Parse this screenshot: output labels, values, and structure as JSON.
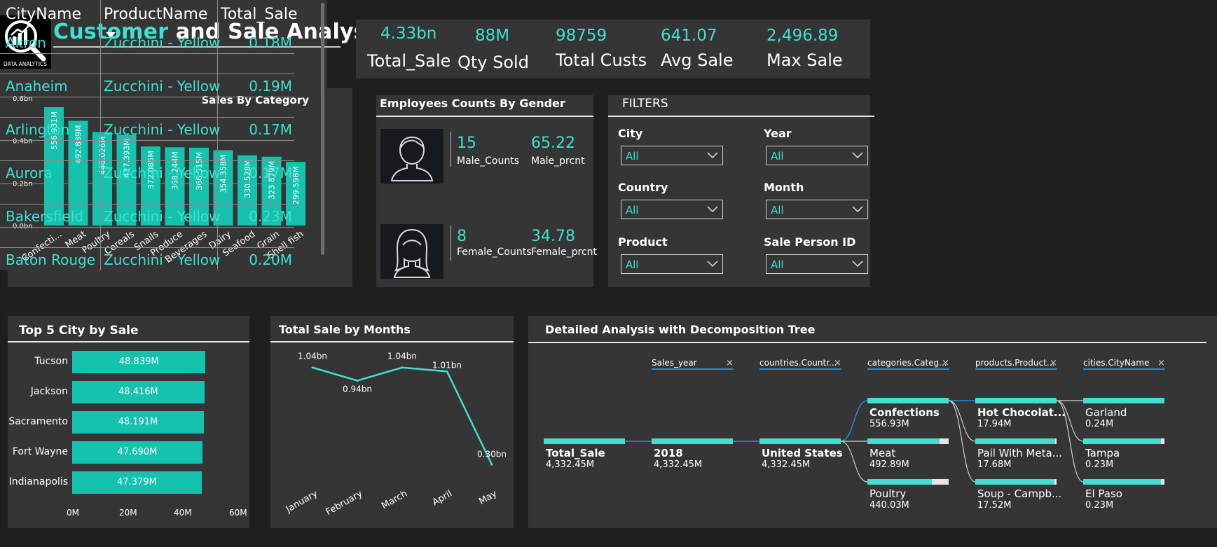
{
  "header": {
    "logo_text": "DATA ANALYTICS",
    "title_part1": "Customer",
    "title_part2": " and Sale Analysis"
  },
  "kpis": [
    {
      "value": "4.33bn",
      "label": "Total_Sale"
    },
    {
      "value": "88M",
      "label": "Qty Sold"
    },
    {
      "value": "98759",
      "label": "Total Custs"
    },
    {
      "value": "641.07",
      "label": "Avg Sale"
    },
    {
      "value": "2,496.89",
      "label": "Max Sale"
    }
  ],
  "colors": {
    "accent": "#3fe0d0",
    "bar": "#15c2ad",
    "panel": "#353535",
    "background": "#1f1f1f",
    "tree_link": "#1f8be0"
  },
  "employees": {
    "title": "Employees Counts By Gender",
    "male": {
      "count": "15",
      "count_label": "Male_Counts",
      "pct": "65.22",
      "pct_label": "Male_prcnt",
      "icon": "male-avatar-icon"
    },
    "female": {
      "count": "8",
      "count_label": "Female_Counts",
      "pct": "34.78",
      "pct_label": "Female_prcnt",
      "icon": "female-avatar-icon"
    }
  },
  "filters": {
    "title": "FILTERS",
    "items": [
      {
        "label": "City",
        "value": "All"
      },
      {
        "label": "Year",
        "value": "All"
      },
      {
        "label": "Country",
        "value": "All"
      },
      {
        "label": "Month",
        "value": "All"
      },
      {
        "label": "Product",
        "value": "All"
      },
      {
        "label": "Sale Person ID",
        "value": "All"
      }
    ]
  },
  "table": {
    "columns": [
      "CityName",
      "ProductName",
      "Total_Sale"
    ],
    "sorted_column": "ProductName",
    "rows": [
      [
        "Akron",
        "Zucchini - Yellow",
        "0.18M"
      ],
      [
        "Anaheim",
        "Zucchini - Yellow",
        "0.19M"
      ],
      [
        "Arlington",
        "Zucchini - Yellow",
        "0.17M"
      ],
      [
        "Aurora",
        "Zucchini - Yellow",
        "0.17M"
      ],
      [
        "Bakersfield",
        "Zucchini - Yellow",
        "0.23M"
      ],
      [
        "Baton Rouge",
        "Zucchini - Yellow",
        "0.20M"
      ]
    ]
  },
  "top5": {
    "title": "Top 5 City by Sale",
    "cities": [
      "Tucson",
      "Jackson",
      "Sacramento",
      "Fort Wayne",
      "Indianapolis"
    ],
    "labels": [
      "48.839M",
      "48.416M",
      "48.191M",
      "47.690M",
      "47.379M"
    ],
    "ticks": [
      "0M",
      "20M",
      "40M",
      "60M"
    ]
  },
  "decomp": {
    "title": "Detailed Analysis with Decomposition Tree",
    "levels": [
      "Sales_year",
      "countries.Countr...",
      "categories.Categ...",
      "products.Product...",
      "cities.CityName"
    ],
    "root": {
      "name": "Total_Sale",
      "value": "4,332.45M"
    },
    "year": {
      "name": "2018",
      "value": "4,332.45M"
    },
    "country": {
      "name": "United States",
      "value": "4,332.45M"
    },
    "categories": [
      {
        "name": "Confections",
        "value": "556.93M",
        "fill": 1.0
      },
      {
        "name": "Meat",
        "value": "492.89M",
        "fill": 0.885
      },
      {
        "name": "Poultry",
        "value": "440.03M",
        "fill": 0.79
      }
    ],
    "products": [
      {
        "name": "Hot Chocolat...",
        "value": "17.94M",
        "fill": 1.0
      },
      {
        "name": "Pail With Meta...",
        "value": "17.68M",
        "fill": 0.985
      },
      {
        "name": "Soup - Campb...",
        "value": "17.52M",
        "fill": 0.977
      }
    ],
    "cities": [
      {
        "name": "Garland",
        "value": "0.24M",
        "fill": 1.0
      },
      {
        "name": "Tampa",
        "value": "0.23M",
        "fill": 0.958
      },
      {
        "name": "El Paso",
        "value": "0.23M",
        "fill": 0.958
      }
    ]
  },
  "chart_data": [
    {
      "type": "bar",
      "title": "Sales By Category",
      "categories": [
        "Confecti...",
        "Meat",
        "Poultry",
        "Cereals",
        "Snails",
        "Produce",
        "Beverages",
        "Dairy",
        "Seafood",
        "Grain",
        "Shell fish"
      ],
      "values": [
        556.931,
        492.889,
        440.026,
        427.393,
        372.085,
        368.244,
        366.515,
        354.358,
        330.528,
        323.879,
        299.598
      ],
      "value_labels": [
        "556.931M",
        "492.889M",
        "440.026M",
        "427.393M",
        "372.085M",
        "368.244M",
        "366.515M",
        "354.358M",
        "330.528M",
        "323.879M",
        "299.598M"
      ],
      "y_ticks": [
        "0.0bn",
        "0.2bn",
        "0.4bn",
        "0.6bn"
      ],
      "ylim": [
        0,
        600
      ],
      "y_unit": "M"
    },
    {
      "type": "bar",
      "title": "Top 5 City by Sale",
      "orientation": "horizontal",
      "categories": [
        "Tucson",
        "Jackson",
        "Sacramento",
        "Fort Wayne",
        "Indianapolis"
      ],
      "values": [
        48.839,
        48.416,
        48.191,
        47.69,
        47.379
      ],
      "xlim": [
        0,
        60
      ]
    },
    {
      "type": "line",
      "title": "Total Sale by Months",
      "categories": [
        "January",
        "February",
        "March",
        "April",
        "May"
      ],
      "values": [
        1.04,
        0.94,
        1.04,
        1.01,
        0.3
      ],
      "value_labels": [
        "1.04bn",
        "0.94bn",
        "1.04bn",
        "1.01bn",
        "0.30bn"
      ],
      "y_unit": "bn"
    }
  ]
}
